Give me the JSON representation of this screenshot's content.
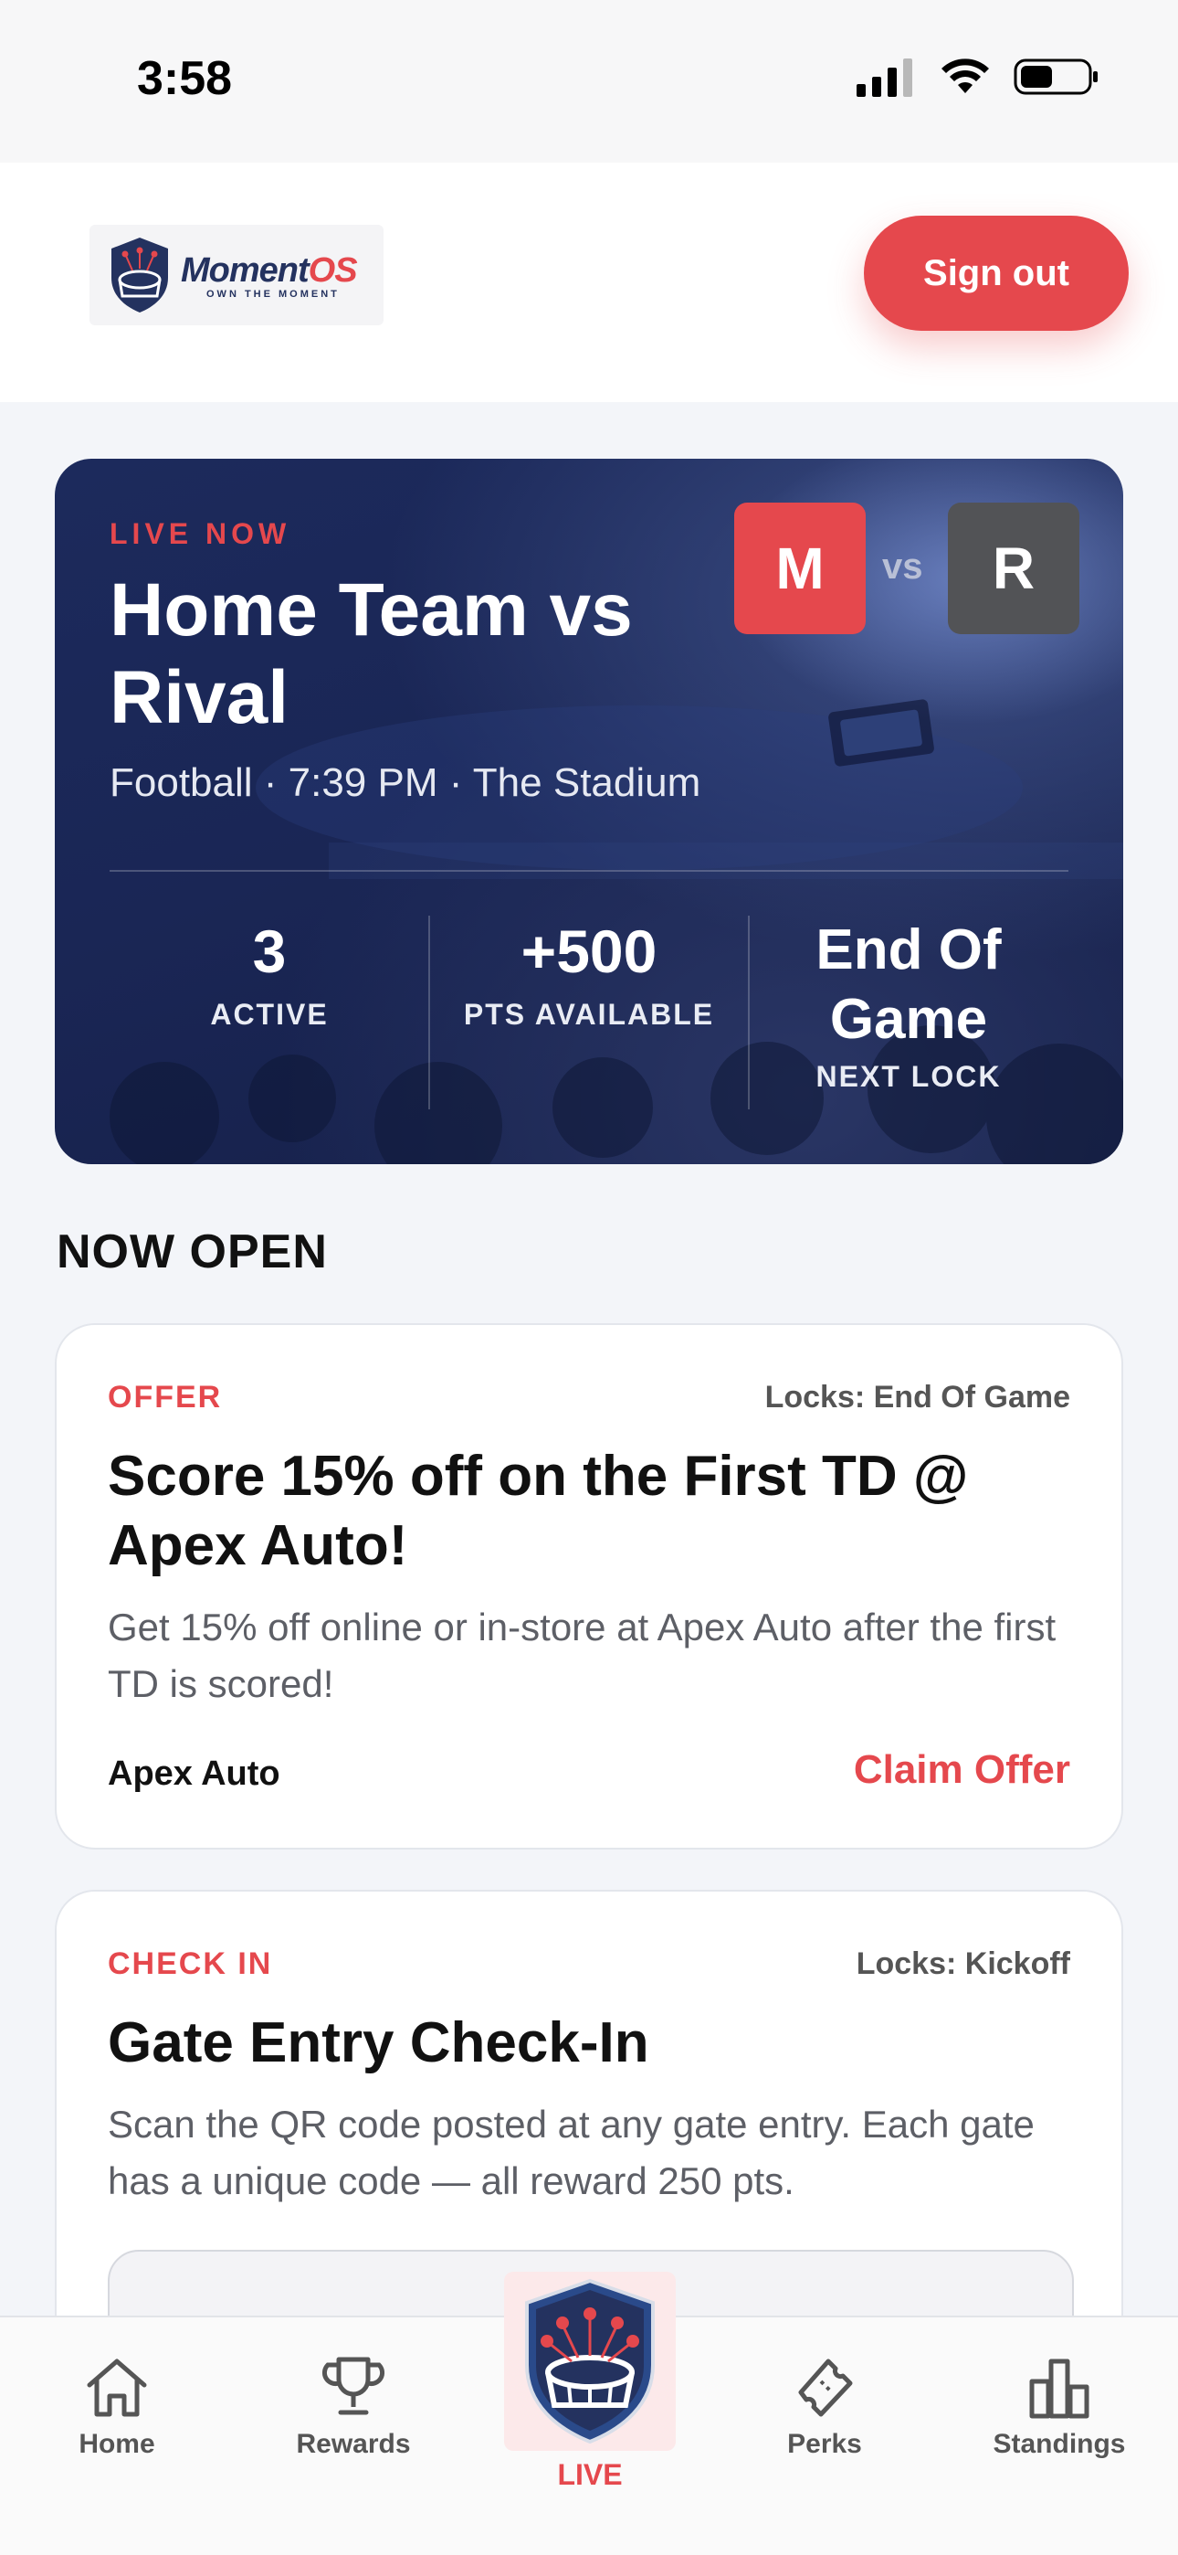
{
  "status_bar": {
    "time": "3:58"
  },
  "header": {
    "logo_name": "Moment",
    "logo_name_accent": "OS",
    "logo_tagline": "OWN THE MOMENT",
    "sign_out_label": "Sign out"
  },
  "hero": {
    "live_label": "LIVE NOW",
    "title": "Home Team vs Rival",
    "meta": "Football · 7:39 PM · The Stadium",
    "home_initial": "M",
    "away_initial": "R",
    "vs": "vs",
    "stats": [
      {
        "value": "3",
        "label": "ACTIVE"
      },
      {
        "value": "+500",
        "label": "PTS AVAILABLE"
      },
      {
        "value": "End Of Game",
        "label": "NEXT LOCK"
      }
    ]
  },
  "section_heading": "NOW OPEN",
  "cards": [
    {
      "type": "OFFER",
      "locks": "Locks: End Of Game",
      "title": "Score 15% off on the First TD @ Apex Auto!",
      "description": "Get 15% off online or in-store at Apex Auto after the first TD is scored!",
      "sponsor": "Apex Auto",
      "cta": "Claim Offer"
    },
    {
      "type": "CHECK IN",
      "locks": "Locks: Kickoff",
      "title": "Gate Entry Check-In",
      "description": "Scan the QR code posted at any gate entry. Each gate has a unique code — all reward 250 pts."
    }
  ],
  "nav": {
    "home": "Home",
    "rewards": "Rewards",
    "live": "LIVE",
    "perks": "Perks",
    "standings": "Standings"
  },
  "colors": {
    "accent": "#e5484d",
    "navy": "#1c2a5c",
    "away_badge": "#525356"
  },
  "icons": [
    "signal-icon",
    "wifi-icon",
    "battery-icon",
    "home-icon",
    "trophy-icon",
    "stadium-shield-icon",
    "ticket-icon",
    "bar-chart-icon"
  ]
}
